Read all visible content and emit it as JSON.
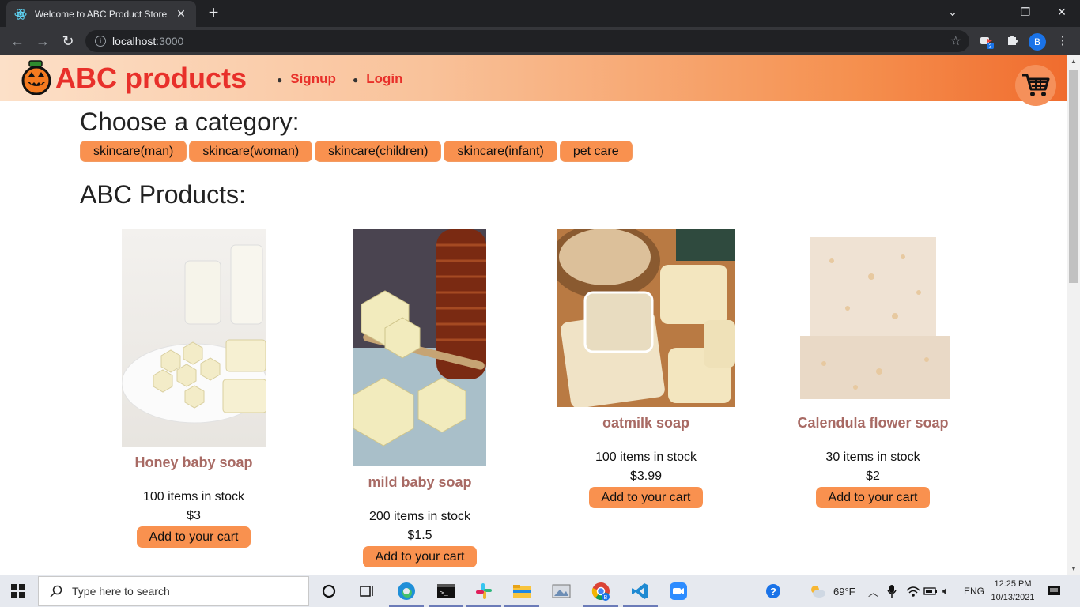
{
  "browser": {
    "tab_title": "Welcome to ABC Product Store",
    "url_host": "localhost",
    "url_port": ":3000",
    "profile_initial": "B",
    "extension_badge": "2"
  },
  "site": {
    "brand": "ABC products",
    "nav": [
      {
        "label": "Signup"
      },
      {
        "label": "Login"
      }
    ]
  },
  "categories_heading": "Choose a category:",
  "categories": [
    "skincare(man)",
    "skincare(woman)",
    "skincare(children)",
    "skincare(infant)",
    "pet care"
  ],
  "products_heading": "ABC Products:",
  "products": [
    {
      "name": "Honey baby soap",
      "stock": "100 items in stock",
      "price": "$3",
      "button": "Add to your cart"
    },
    {
      "name": "mild baby soap",
      "stock": "200 items in stock",
      "price": "$1.5",
      "button": "Add to your cart"
    },
    {
      "name": "oatmilk soap",
      "stock": "100 items in stock",
      "price": "$3.99",
      "button": "Add to your cart"
    },
    {
      "name": "Calendula flower soap",
      "stock": "30 items in stock",
      "price": "$2",
      "button": "Add to your cart"
    }
  ],
  "taskbar": {
    "search_placeholder": "Type here to search",
    "weather": "69°F",
    "language": "ENG",
    "time": "12:25 PM",
    "date": "10/13/2021"
  },
  "colors": {
    "brand_red": "#e8302a",
    "button_orange": "#f9914f",
    "product_name": "#a86a64"
  }
}
